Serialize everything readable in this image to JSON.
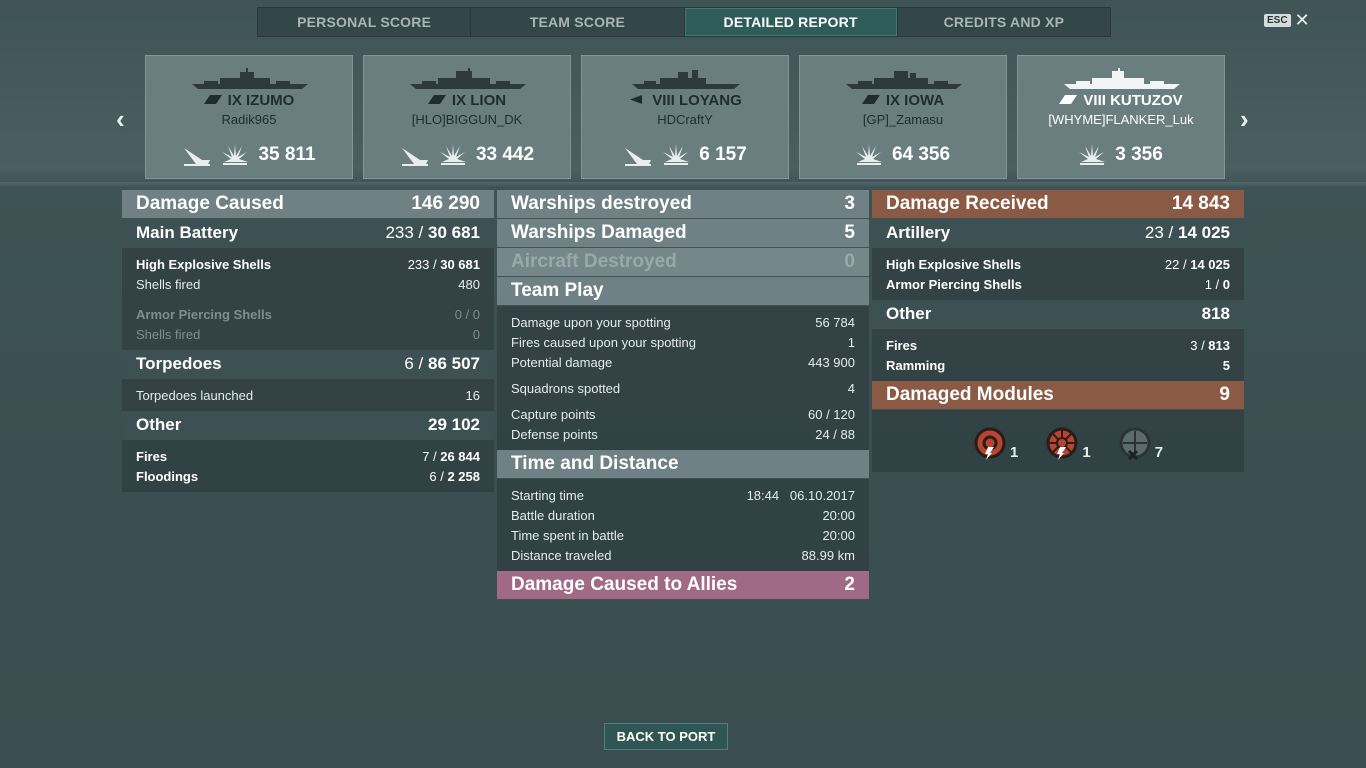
{
  "tabs": [
    "PERSONAL SCORE",
    "TEAM SCORE",
    "DETAILED REPORT",
    "CREDITS AND XP"
  ],
  "esc_label": "ESC",
  "ships": [
    {
      "name": "IX IZUMO",
      "player": "Radik965",
      "damage": "35 811",
      "sunk": true,
      "light": false
    },
    {
      "name": "IX LION",
      "player": "[HLO]BIGGUN_DK",
      "damage": "33 442",
      "sunk": true,
      "light": false
    },
    {
      "name": "VIII LOYANG",
      "player": "HDCraftY",
      "damage": "6 157",
      "sunk": true,
      "light": false
    },
    {
      "name": "IX IOWA",
      "player": "[GP]_Zamasu",
      "damage": "64 356",
      "sunk": false,
      "light": false
    },
    {
      "name": "VIII KUTUZOV",
      "player": "[WHYME]FLANKER_Luk",
      "damage": "3 356",
      "sunk": false,
      "light": true
    }
  ],
  "damage_caused": {
    "title": "Damage Caused",
    "value": "146 290",
    "main_battery": {
      "title": "Main Battery",
      "hits": "233",
      "value": "30 681"
    },
    "he": {
      "label": "High Explosive Shells",
      "hits": "233",
      "value": "30 681",
      "fired_label": "Shells fired",
      "fired": "480"
    },
    "ap": {
      "label": "Armor Piercing Shells",
      "hits": "0",
      "value": "0",
      "fired_label": "Shells fired",
      "fired": "0"
    },
    "torpedoes": {
      "title": "Torpedoes",
      "hits": "6",
      "value": "86 507",
      "launched_label": "Torpedoes launched",
      "launched": "16"
    },
    "other": {
      "title": "Other",
      "value": "29 102",
      "fires_label": "Fires",
      "fires_hits": "7",
      "fires_value": "26 844",
      "flood_label": "Floodings",
      "flood_hits": "6",
      "flood_value": "2 258"
    }
  },
  "middle": {
    "destroyed": {
      "title": "Warships destroyed",
      "value": "3"
    },
    "damaged": {
      "title": "Warships Damaged",
      "value": "5"
    },
    "aircraft": {
      "title": "Aircraft Destroyed",
      "value": "0"
    },
    "team_play": {
      "title": "Team Play",
      "rows": [
        {
          "label": "Damage upon your spotting",
          "value": "56 784"
        },
        {
          "label": "Fires caused upon your spotting",
          "value": "1"
        },
        {
          "label": "Potential damage",
          "value": "443 900"
        },
        {
          "label": "Squadrons spotted",
          "value": "4"
        },
        {
          "label": "Capture points",
          "value": "60 / 120"
        },
        {
          "label": "Defense points",
          "value": "24 / 88"
        }
      ]
    },
    "time": {
      "title": "Time and Distance",
      "rows": [
        {
          "label": "Starting time",
          "value": "18:44   06.10.2017"
        },
        {
          "label": "Battle duration",
          "value": "20:00"
        },
        {
          "label": "Time spent in battle",
          "value": "20:00"
        },
        {
          "label": "Distance traveled",
          "value": "88.99 km"
        }
      ]
    },
    "allies": {
      "title": "Damage Caused to Allies",
      "value": "2"
    }
  },
  "damage_received": {
    "title": "Damage Received",
    "value": "14 843",
    "artillery": {
      "title": "Artillery",
      "hits": "23",
      "value": "14 025"
    },
    "he": {
      "label": "High Explosive Shells",
      "hits": "22",
      "value": "14 025"
    },
    "ap": {
      "label": "Armor Piercing Shells",
      "hits": "1",
      "value": "0"
    },
    "other": {
      "title": "Other",
      "value": "818",
      "fires_label": "Fires",
      "fires_hits": "3",
      "fires_value": "813",
      "ram_label": "Ramming",
      "ram_value": "5"
    },
    "modules": {
      "title": "Damaged Modules",
      "value": "9",
      "items": [
        {
          "icon": "engine-damaged-icon",
          "count": "1"
        },
        {
          "icon": "steering-damaged-icon",
          "count": "1"
        },
        {
          "icon": "turret-destroyed-icon",
          "count": "7"
        }
      ]
    }
  },
  "back_button": "BACK TO PORT"
}
